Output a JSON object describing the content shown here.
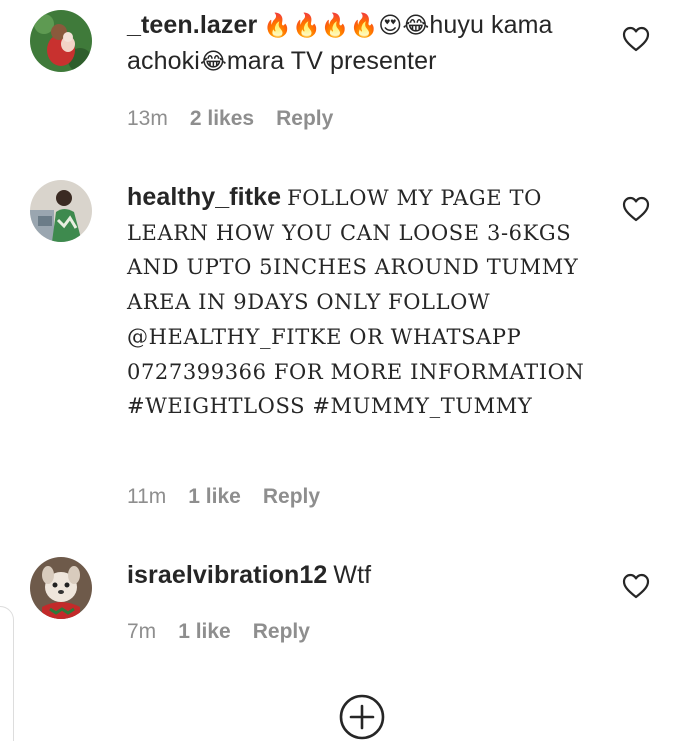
{
  "comments": [
    {
      "username": "_teen.lazer",
      "text_emojis_1": "🔥🔥🔥🔥😍😂",
      "text_part_1": "huyu kama achoki",
      "text_emoji_2": "😂",
      "text_part_2": "mara TV presenter",
      "time": "13m",
      "likes": "2 likes",
      "reply": "Reply",
      "avatar_icon": "profile-photo-woman-with-baby",
      "like_icon": "heart-outline"
    },
    {
      "username": "healthy_fitke",
      "text": "FOLLOW MY PAGE TO LEARN HOW YOU CAN LOOSE 3-6KGS AND UPTO 5INCHES AROUND TUMMY AREA IN 9DAYS ONLY FOLLOW @HEALTHY_FITKE OR WHATSAPP 0727399366 FOR MORE INFORMATION #WEIGHTLOSS #MUMMY_TUMMY",
      "time": "11m",
      "likes": "1 like",
      "reply": "Reply",
      "avatar_icon": "profile-photo-person-green-dress",
      "like_icon": "heart-outline"
    },
    {
      "username": "israelvibration12",
      "text": "Wtf",
      "time": "7m",
      "likes": "1 like",
      "reply": "Reply",
      "avatar_icon": "profile-photo-dog",
      "like_icon": "heart-outline"
    }
  ],
  "footer": {
    "add_icon": "plus-circle-icon"
  },
  "colors": {
    "text": "#262626",
    "secondary": "#8e8e8e"
  }
}
